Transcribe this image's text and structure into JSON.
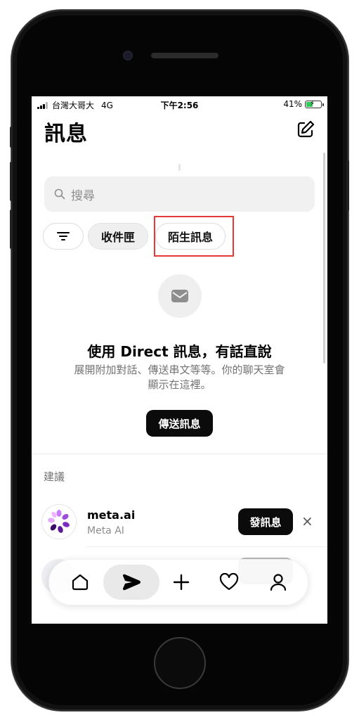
{
  "status": {
    "carrier": "台灣大哥大",
    "network": "4G",
    "time": "下午2:56",
    "battery": "41%"
  },
  "header": {
    "title": "訊息",
    "compose_icon": "compose-icon"
  },
  "search": {
    "placeholder": "搜尋"
  },
  "filters": {
    "filter_icon": "filter-icon",
    "items": [
      "收件匣",
      "陌生訊息"
    ]
  },
  "empty_state": {
    "icon": "mail-icon",
    "title": "使用 Direct 訊息，有話直說",
    "description": "展開附加對話、傳送串文等等。你的聊天室會顯示在這裡。",
    "button_label": "傳送訊息"
  },
  "suggestions": {
    "label": "建議",
    "items": [
      {
        "name": "meta.ai",
        "subtitle": "Meta AI",
        "button_label": "發訊息",
        "close": "×"
      }
    ]
  },
  "tabbar": {
    "items": [
      "home-icon",
      "direct-icon",
      "plus-icon",
      "heart-icon",
      "profile-icon"
    ],
    "active": "direct-icon"
  },
  "colors": {
    "highlight": "#e53935",
    "battery": "#34c759",
    "primary_button": "#0b0b0b"
  }
}
